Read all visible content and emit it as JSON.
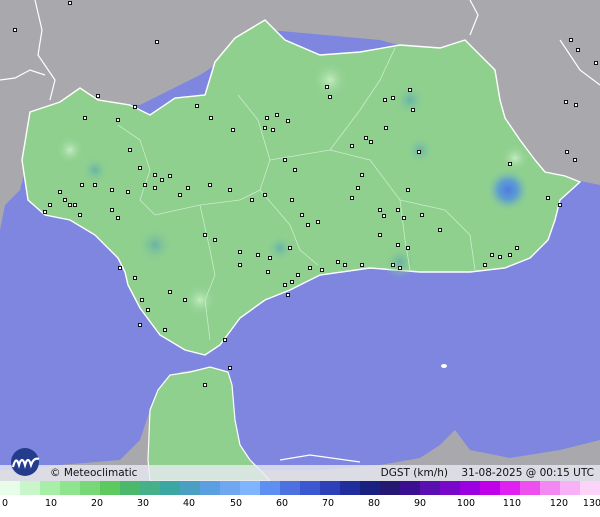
{
  "map": {
    "brand": "Meteoclimatic",
    "copyright_symbol": "©",
    "variable_unit": "DGST (km/h)",
    "datetime": "31-08-2025 @ 00:15 UTC",
    "colors": {
      "sea": "#7f86e0",
      "land_outside": "#a9a9ad",
      "region_fill": "#8fd08f",
      "region_edge": "#ffffff",
      "station_marker": "#000000"
    }
  },
  "scale": {
    "ticks": [
      "0",
      "10",
      "20",
      "30",
      "40",
      "50",
      "60",
      "70",
      "80",
      "90",
      "100",
      "110",
      "120",
      "130"
    ],
    "colors": [
      "#e8fde8",
      "#c8f6c8",
      "#a8eea8",
      "#8ee58e",
      "#78d878",
      "#5ec95e",
      "#4cb86c",
      "#46b08a",
      "#3aa7a3",
      "#4aa0c0",
      "#5aa0e0",
      "#6fa8f0",
      "#7fb4ff",
      "#5f8ff0",
      "#4d72e0",
      "#3b58d0",
      "#2c40b8",
      "#1f2e9c",
      "#1a2080",
      "#241870",
      "#3a1090",
      "#5a10b0",
      "#7a08c8",
      "#9a00e0",
      "#c000e8",
      "#e020f0",
      "#ee50f0",
      "#f488f2",
      "#f8b0f6",
      "#fcd4fa"
    ]
  }
}
